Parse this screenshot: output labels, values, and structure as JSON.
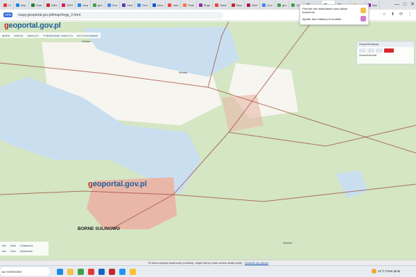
{
  "browser": {
    "tabs": [
      {
        "label": "Ci",
        "color": "#e53935"
      },
      {
        "label": "mep",
        "color": "#1e88e5"
      },
      {
        "label": "Chat",
        "color": "#2e7d32"
      },
      {
        "label": "Nitro",
        "color": "#c62828"
      },
      {
        "label": "ERO",
        "color": "#d81b60"
      },
      {
        "label": "mep",
        "color": "#1e88e5"
      },
      {
        "label": "geo",
        "color": "#43a047"
      },
      {
        "label": "Goo",
        "color": "#4285f4"
      },
      {
        "label": "Vent",
        "color": "#5e35b1"
      },
      {
        "label": "Goo",
        "color": "#4285f4"
      },
      {
        "label": "Accc",
        "color": "#0b57d0"
      },
      {
        "label": "rank",
        "color": "#ea4335"
      },
      {
        "label": "Pratt",
        "color": "#ff7043"
      },
      {
        "label": "Rege",
        "color": "#9c27b0"
      },
      {
        "label": "Rank",
        "color": "#ea4335"
      },
      {
        "label": "Repr",
        "color": "#c62828"
      },
      {
        "label": "Wint",
        "color": "#ad1457"
      },
      {
        "label": "Goo",
        "color": "#4285f4"
      },
      {
        "label": "geo",
        "color": "#43a047"
      },
      {
        "label": "Geo",
        "color": "#43a047"
      },
      {
        "label": "stacje",
        "color": "#546e7a"
      },
      {
        "label": "geo",
        "color": "#43a047"
      },
      {
        "label": "Geo",
        "color": "#43a047"
      },
      {
        "label": "Nyc",
        "color": "#fbc02d"
      },
      {
        "label": "Mys",
        "color": "#8e24aa"
      }
    ],
    "window_controls": [
      "—",
      "□",
      "✕"
    ],
    "vpn_label": "VPN",
    "url": "mapy.geoportal.gov.pl/imap/Imgp_2.html",
    "addr_icons": [
      "☆",
      "⬇",
      "⟳",
      "⋮"
    ]
  },
  "geoportal": {
    "logo_prefix": "g",
    "logo_rest": "eoportal.gov.pl",
    "nav": [
      "MAPA",
      "WIDOK",
      "ANALIZY",
      "POBIERANIE DANYCH",
      "WYSZUKIWANIE"
    ]
  },
  "map": {
    "logo_prefix": "g",
    "logo_rest": "eoportal.gov.pl",
    "place_main": "BORNE SULINOWO",
    "place_small_1": "Łubowo",
    "place_small_2": "Silnowo",
    "place_small_3": "Jeziorna",
    "toolbar_title": "Geoportal krajowy",
    "toolbar_text": "Znowu/Kierunek",
    "bottom_rows": [
      [
        "Info",
        "Dane",
        "Dokładność"
      ],
      [
        "Ruch",
        "Strefa",
        "Stereoskop"
      ],
      [
        "Info",
        "Zone",
        "Dokładność"
      ]
    ]
  },
  "popup": {
    "line1": "Prendre des instantanés sans utiliser Imprécran",
    "line2": "Ajouter des relations et modifier"
  },
  "cookies": {
    "text": "Ta strona używa ciasteczek (cookies), dzięki którym nasz serwis działa lepiej.",
    "link": "Dowiedz się więcej"
  },
  "taskbar": {
    "search": "our rechercher",
    "weather": "11°C  Forte pluie",
    "icons": [
      {
        "name": "edge-icon",
        "color": "#1e88e5"
      },
      {
        "name": "files-icon",
        "color": "#f6c344"
      },
      {
        "name": "store-icon",
        "color": "#43a047"
      },
      {
        "name": "chrome-icon",
        "color": "#e53935"
      },
      {
        "name": "word-icon",
        "color": "#1565c0"
      },
      {
        "name": "opera-icon",
        "color": "#c62828"
      },
      {
        "name": "mail-icon",
        "color": "#2196f3"
      },
      {
        "name": "explorer-icon",
        "color": "#fbc02d"
      }
    ]
  },
  "colors": {
    "forest": "#d4e6c4",
    "field": "#f7f5ef",
    "water": "#c9dff0",
    "road": "#9a3c2a",
    "town": "#e9b7a8"
  }
}
